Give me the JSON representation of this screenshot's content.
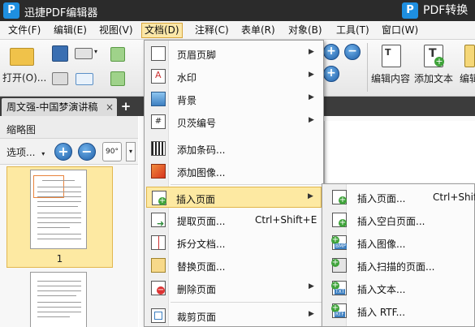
{
  "titlebar": {
    "app_title": "迅捷PDF编辑器",
    "convert_label": "PDF转换"
  },
  "menubar": {
    "items": [
      {
        "label": "文件(F)"
      },
      {
        "label": "编辑(E)"
      },
      {
        "label": "视图(V)"
      },
      {
        "label": "文档(D)"
      },
      {
        "label": "注释(C)"
      },
      {
        "label": "表单(R)"
      },
      {
        "label": "对象(B)"
      },
      {
        "label": "工具(T)"
      },
      {
        "label": "窗口(W)"
      }
    ]
  },
  "toolbar": {
    "open_label": "打开(O)...",
    "edit_content_label": "编辑内容",
    "add_text_label": "添加文本",
    "edit_partial_label": "编辑"
  },
  "tab": {
    "title": "周文强-中国梦演讲稿",
    "close": "×",
    "new": "+"
  },
  "panel": {
    "title": "缩略图",
    "options_label": "选项...",
    "rotate_label": "90°",
    "page_number": "1"
  },
  "doc_menu": {
    "items": [
      {
        "label": "页眉页脚",
        "has_submenu": true,
        "icon": "header-footer-icon"
      },
      {
        "label": "水印",
        "has_submenu": true,
        "icon": "watermark-icon"
      },
      {
        "label": "背景",
        "has_submenu": true,
        "icon": "background-icon"
      },
      {
        "label": "贝茨编号",
        "has_submenu": true,
        "icon": "bates-number-icon"
      },
      {
        "label": "添加条码...",
        "icon": "barcode-icon"
      },
      {
        "label": "添加图像...",
        "icon": "add-image-icon"
      },
      {
        "label": "插入页面",
        "has_submenu": true,
        "highlighted": true,
        "icon": "insert-page-icon"
      },
      {
        "label": "提取页面...",
        "shortcut": "Ctrl+Shift+E",
        "icon": "extract-page-icon"
      },
      {
        "label": "拆分文档...",
        "icon": "split-document-icon"
      },
      {
        "label": "替换页面...",
        "icon": "replace-page-icon"
      },
      {
        "label": "删除页面",
        "has_submenu": true,
        "icon": "delete-page-icon"
      },
      {
        "label": "裁剪页面",
        "has_submenu": true,
        "icon": "crop-page-icon"
      }
    ]
  },
  "insert_submenu": {
    "items": [
      {
        "label": "插入页面...",
        "shortcut": "Ctrl+Shift",
        "icon": "insert-page-icon"
      },
      {
        "label": "插入空白页面...",
        "icon": "insert-blank-page-icon"
      },
      {
        "label": "插入图像...",
        "icon": "insert-image-bmp-icon",
        "badge": "BMP"
      },
      {
        "label": "插入扫描的页面...",
        "icon": "insert-scanned-page-icon"
      },
      {
        "label": "插入文本...",
        "icon": "insert-text-icon",
        "badge": "TXT"
      },
      {
        "label": "插入 RTF...",
        "icon": "insert-rtf-icon",
        "badge": "RTF"
      }
    ]
  },
  "colors": {
    "titlebar": "#2b2b2b",
    "highlight": "#fde9a2",
    "highlight_border": "#e0b64b",
    "accent_blue": "#1e8fe0"
  }
}
